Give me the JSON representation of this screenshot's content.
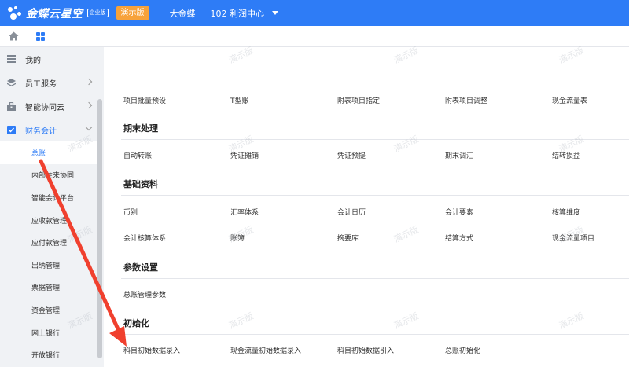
{
  "topbar": {
    "logo_text": "金蝶云星空",
    "logo_badge": "企业版",
    "demo_tag": "演示版",
    "org": "大金蝶",
    "center": "102  利润中心"
  },
  "sidebar": {
    "items": [
      {
        "label": "我的"
      },
      {
        "label": "员工服务"
      },
      {
        "label": "智能协同云"
      },
      {
        "label": "财务会计"
      }
    ],
    "subitems": [
      {
        "label": "总账"
      },
      {
        "label": "内部往来协同"
      },
      {
        "label": "智能会计平台"
      },
      {
        "label": "应收款管理"
      },
      {
        "label": "应付款管理"
      },
      {
        "label": "出纳管理"
      },
      {
        "label": "票据管理"
      },
      {
        "label": "资金管理"
      },
      {
        "label": "网上银行"
      },
      {
        "label": "开放银行"
      }
    ]
  },
  "main": {
    "top_links": [
      "项目批量预设",
      "T型账",
      "附表项目指定",
      "附表项目调整",
      "现金流量表"
    ],
    "sections": [
      {
        "title": "期末处理",
        "links": [
          "自动转账",
          "凭证摊销",
          "凭证预提",
          "期末调汇",
          "结转损益"
        ]
      },
      {
        "title": "基础资料",
        "links": [
          "币别",
          "汇率体系",
          "会计日历",
          "会计要素",
          "核算维度",
          "会计核算体系",
          "账簿",
          "摘要库",
          "结算方式",
          "现金流量项目"
        ]
      },
      {
        "title": "参数设置",
        "links": [
          "总账管理参数"
        ]
      },
      {
        "title": "初始化",
        "links": [
          "科目初始数据录入",
          "现金流量初始数据录入",
          "科目初始数据引入",
          "总账初始化"
        ]
      }
    ]
  },
  "watermark": "演示版",
  "colors": {
    "brand": "#2e7cf6",
    "demo": "#f7a23b",
    "annotation": "#f0402e"
  }
}
